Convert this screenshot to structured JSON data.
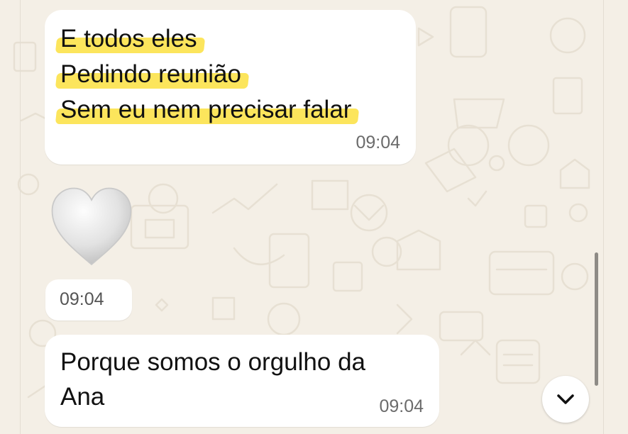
{
  "messages": [
    {
      "lines": [
        "E todos eles",
        "Pedindo reunião",
        "Sem eu nem precisar falar"
      ],
      "time": "09:04",
      "highlight_color": "#fce55c"
    },
    {
      "emoji": "white-heart",
      "time": "09:04"
    },
    {
      "lines": [
        "Porque somos o orgulho da",
        "Ana"
      ],
      "time": "09:04"
    }
  ],
  "scroll_button": {
    "icon": "chevron-down-icon"
  },
  "colors": {
    "wallpaper": "#f4efe6",
    "bubble": "#ffffff",
    "highlight": "#fce55c",
    "time": "#6b6b6b"
  }
}
